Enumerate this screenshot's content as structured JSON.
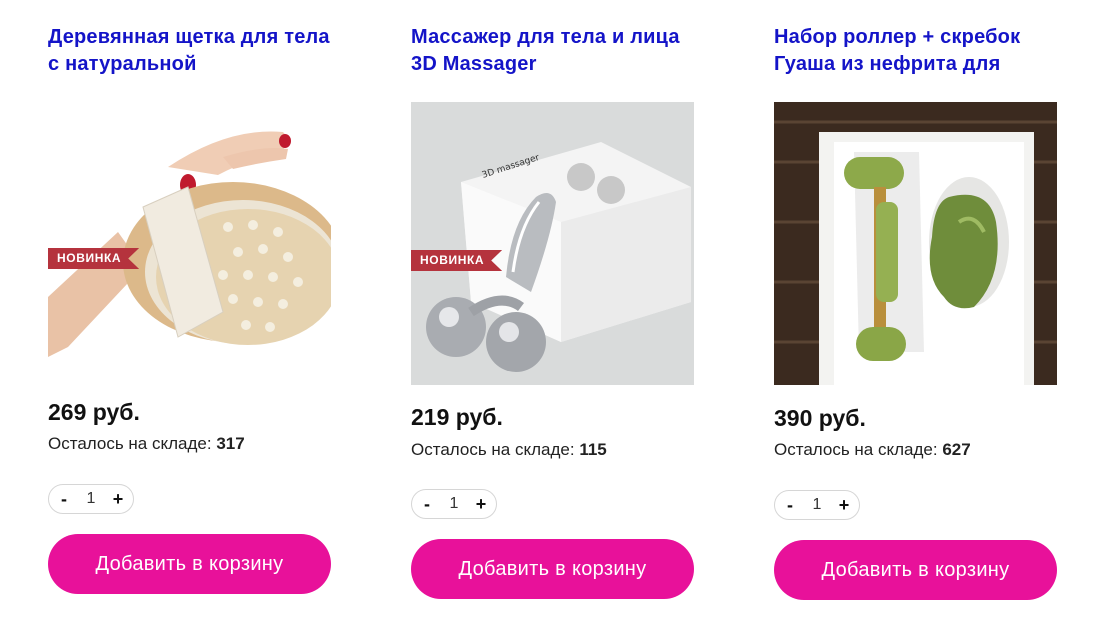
{
  "products": [
    {
      "title": "Деревянная щетка для тела с натуральной",
      "badge": "НОВИНКА",
      "price": "269 руб.",
      "stock_label": "Осталось на складе:",
      "stock_value": "317",
      "minus": "-",
      "plus": "+",
      "qty": "1",
      "cart_label": "Добавить в корзину"
    },
    {
      "title": "Массажер для тела и лица 3D Massager",
      "badge": "НОВИНКА",
      "price": "219 руб.",
      "stock_label": "Осталось на складе:",
      "stock_value": "115",
      "minus": "-",
      "plus": "+",
      "qty": "1",
      "cart_label": "Добавить в корзину"
    },
    {
      "title": "Набор роллер + скребок Гуаша из нефрита для",
      "price": "390 руб.",
      "stock_label": "Осталось на складе:",
      "stock_value": "627",
      "minus": "-",
      "plus": "+",
      "qty": "1",
      "cart_label": "Добавить в корзину"
    }
  ],
  "colors": {
    "title": "#1414c8",
    "badge": "#b5333d",
    "cart_button": "#e8119a"
  }
}
